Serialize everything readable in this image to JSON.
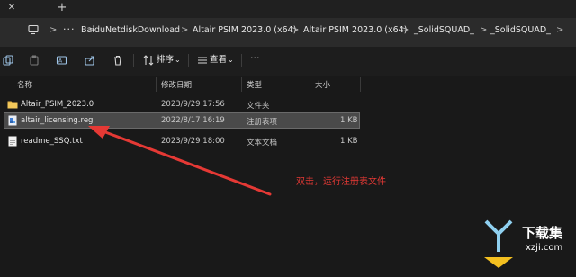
{
  "address": {
    "more_label": "···",
    "crumbs": [
      "BaiduNetdiskDownload",
      "Altair PSIM 2023.0 (x64)",
      "Altair PSIM 2023.0 (x64)",
      "_SolidSQUAD_",
      "_SolidSQUAD_"
    ],
    "separator": ">"
  },
  "toolbar": {
    "sort_label": "排序",
    "view_label": "查看",
    "more_label": "···"
  },
  "columns": [
    "名称",
    "修改日期",
    "类型",
    "大小"
  ],
  "files": [
    {
      "name": "Altair_PSIM_2023.0",
      "modified": "2023/9/29 17:56",
      "type": "文件夹",
      "size": "",
      "icon": "folder-icon"
    },
    {
      "name": "altair_licensing.reg",
      "modified": "2022/8/17 16:19",
      "type": "注册表项",
      "size": "1 KB",
      "icon": "registry-file-icon",
      "selected": true
    },
    {
      "name": "readme_SSQ.txt",
      "modified": "2023/9/29 18:00",
      "type": "文本文档",
      "size": "1 KB",
      "icon": "text-file-icon"
    }
  ],
  "annotation": "双击，运行注册表文件",
  "watermark": {
    "title": "下载集",
    "url": "xzji.com"
  },
  "colors": {
    "annotation": "#e53935",
    "background": "#191919",
    "selection": "#4a4a4a",
    "folder": "#e8b84a"
  }
}
